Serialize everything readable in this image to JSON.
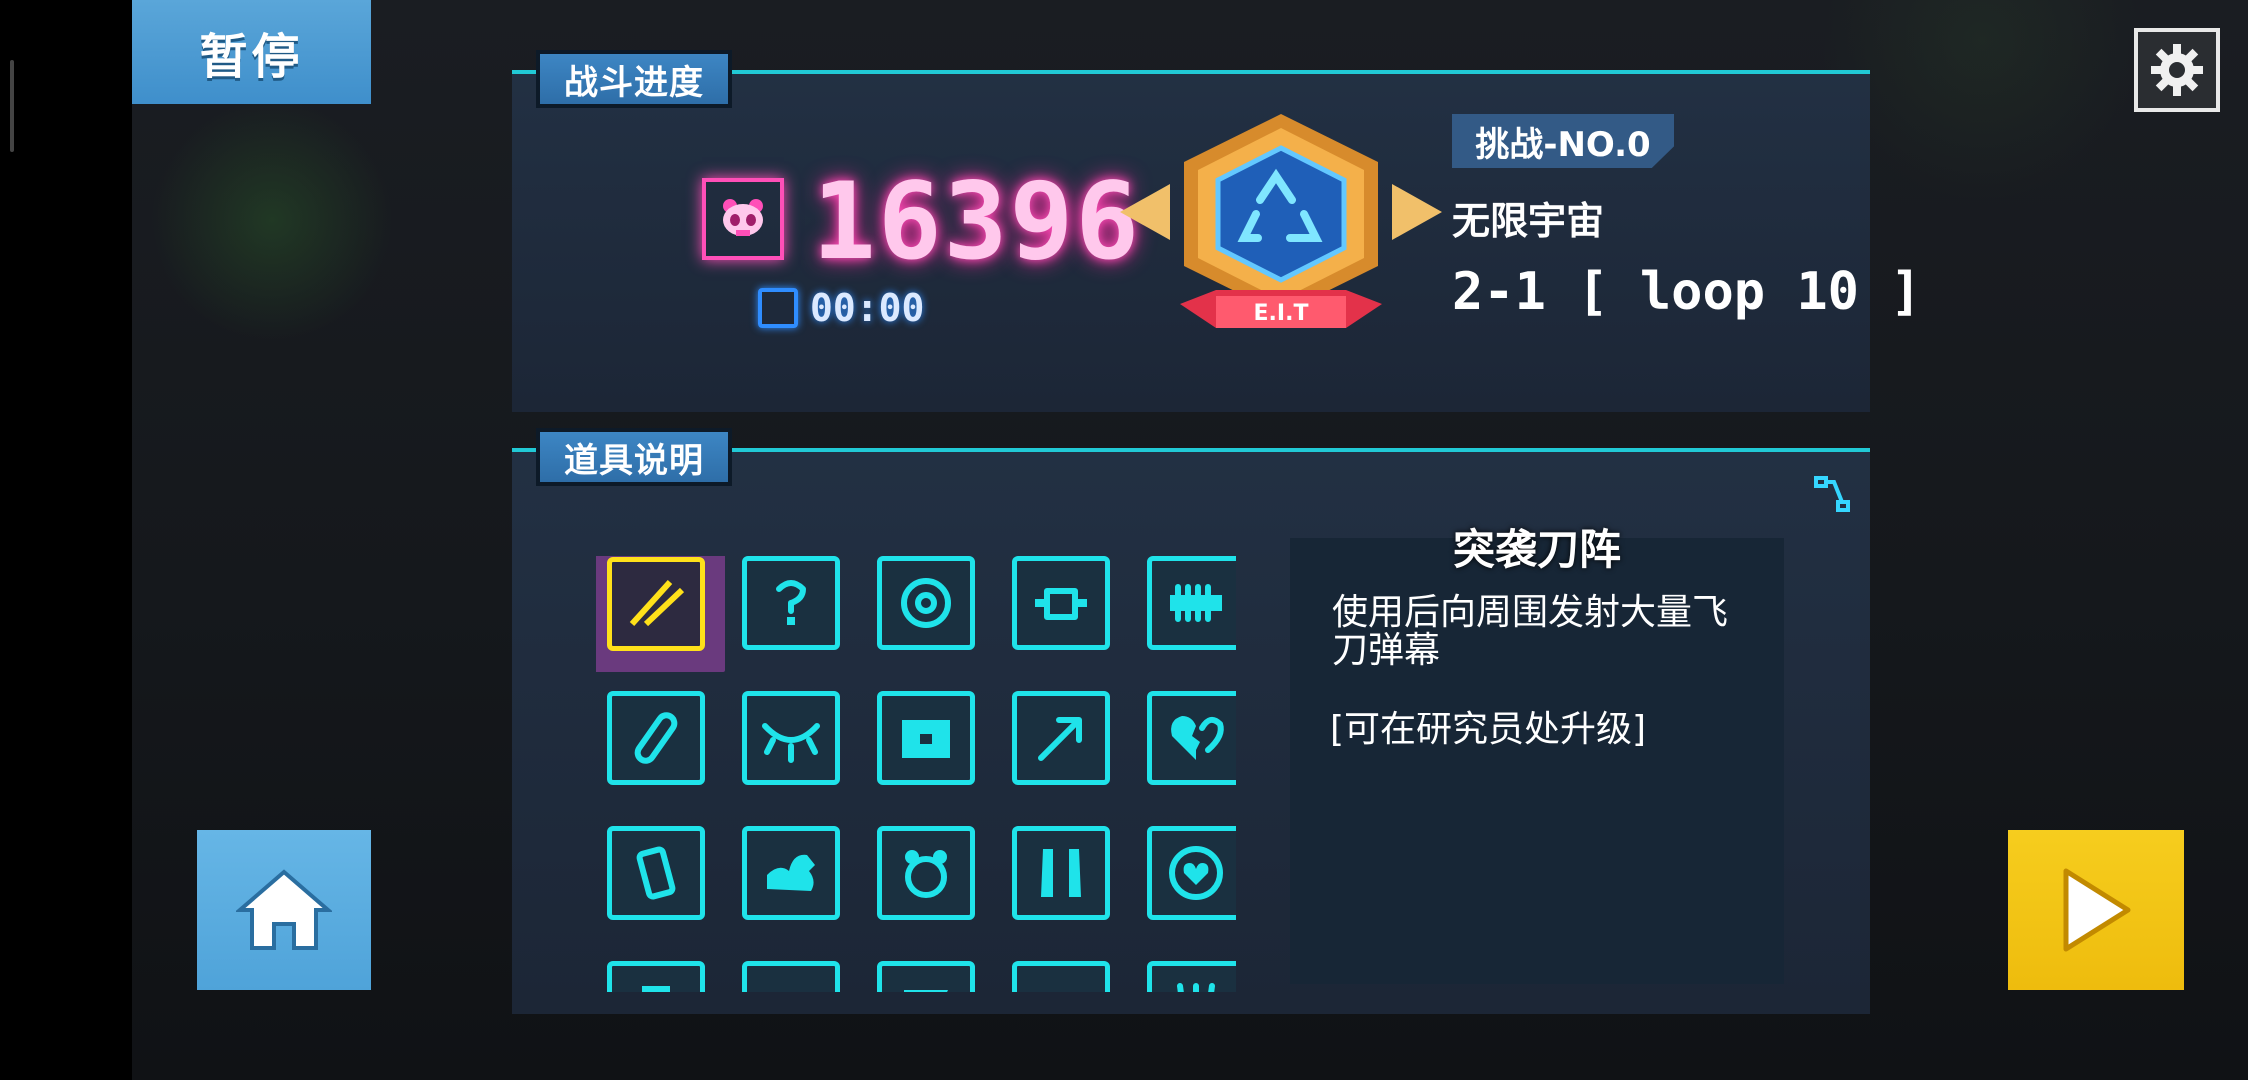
{
  "pause": {
    "label": "暂停"
  },
  "progress": {
    "title": "战斗进度",
    "score": "16396",
    "timer": "00:00",
    "badge_ribbon": "E.I.T",
    "challenge": "挑战-NO.0",
    "world": "无限宇宙",
    "level": "2-1 [ loop 10 ]"
  },
  "items": {
    "title": "道具说明",
    "selected": {
      "name": "突袭刀阵",
      "description": "使用后向周围发射大量飞刀弹幕",
      "upgrade_note": "[可在研究员处升级]"
    },
    "icons": [
      "knife-barrage-icon",
      "mystery-icon",
      "ring-icon",
      "drone-icon",
      "spike-bar-icon",
      "capsule-icon",
      "eye-trap-icon",
      "chest-icon",
      "arrow-icon",
      "broken-heart-icon",
      "battery-icon",
      "muscle-arm-icon",
      "panda-icon",
      "vest-icon",
      "heart-shield-icon",
      "item-icon",
      "dome-icon",
      "flag-icon",
      "scroll-icon",
      "claw-icon"
    ]
  },
  "colors": {
    "accent_cyan": "#1fe3ea",
    "score_pink": "#ff4fb8",
    "pause_blue": "#3f8fcb",
    "play_yellow": "#f2c416",
    "selected_yellow": "#ffe11a"
  }
}
